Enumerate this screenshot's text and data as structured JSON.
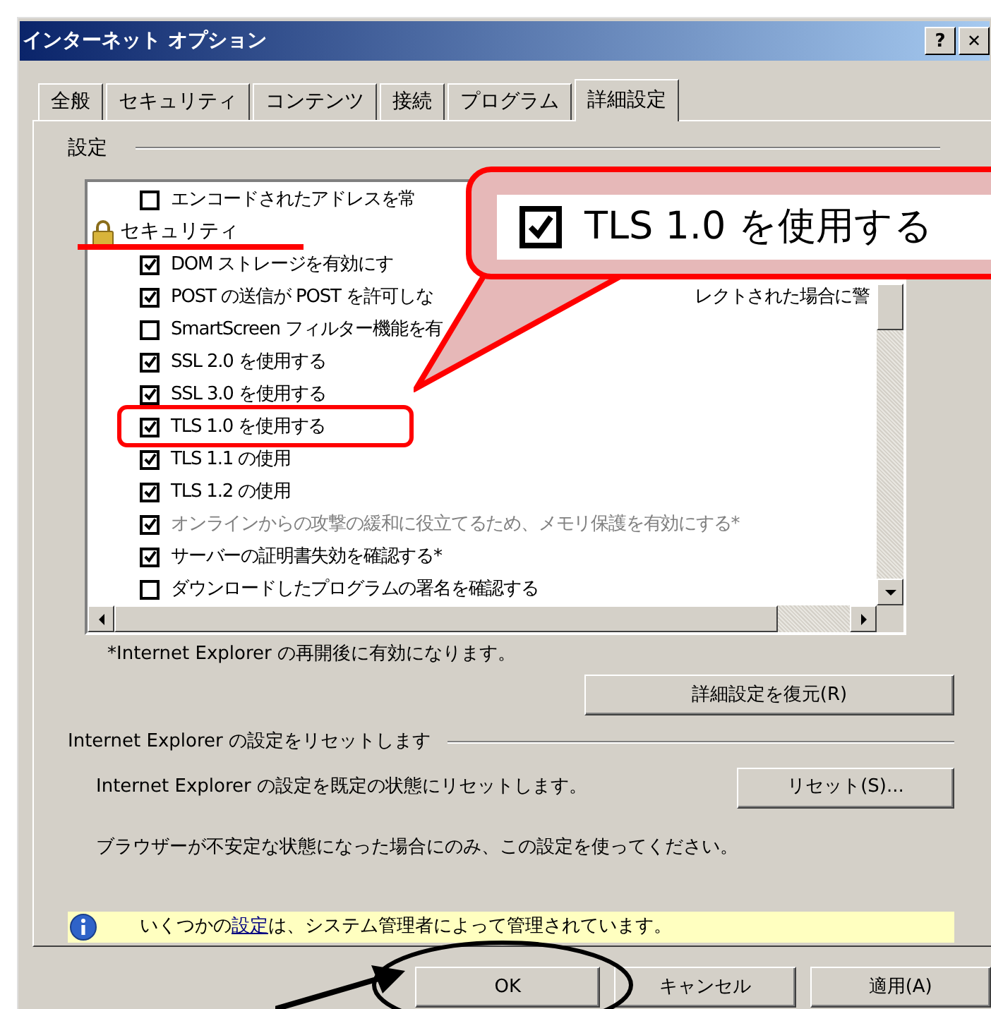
{
  "window": {
    "title": "インターネット オプション",
    "help_button": "?",
    "close_button": "✕"
  },
  "tabs": [
    {
      "label": "全般",
      "selected": false
    },
    {
      "label": "セキュリティ",
      "selected": false
    },
    {
      "label": "コンテンツ",
      "selected": false
    },
    {
      "label": "接続",
      "selected": false
    },
    {
      "label": "プログラム",
      "selected": false
    },
    {
      "label": "詳細設定",
      "selected": true
    }
  ],
  "settings": {
    "heading": "設定",
    "items": [
      {
        "kind": "checkbox",
        "text": "エンコードされたアドレスを常",
        "checked": false,
        "disabled": false
      },
      {
        "kind": "category",
        "text": "セキュリティ"
      },
      {
        "kind": "checkbox",
        "text": "DOM ストレージを有効にす",
        "checked": true,
        "disabled": false
      },
      {
        "kind": "checkbox",
        "text": "POST の送信が POST を許可しな",
        "tail": "レクトされた場合に警",
        "checked": true,
        "disabled": false
      },
      {
        "kind": "checkbox",
        "text": "SmartScreen フィルター機能を有",
        "checked": false,
        "disabled": false
      },
      {
        "kind": "checkbox",
        "text": "SSL 2.0 を使用する",
        "checked": true,
        "disabled": false
      },
      {
        "kind": "checkbox",
        "text": "SSL 3.0 を使用する",
        "checked": true,
        "disabled": false
      },
      {
        "kind": "checkbox",
        "text": "TLS 1.0 を使用する",
        "checked": true,
        "disabled": false
      },
      {
        "kind": "checkbox",
        "text": "TLS 1.1 の使用",
        "checked": true,
        "disabled": false
      },
      {
        "kind": "checkbox",
        "text": "TLS 1.2 の使用",
        "checked": true,
        "disabled": false
      },
      {
        "kind": "checkbox",
        "text": "オンラインからの攻撃の緩和に役立てるため、メモリ保護を有効にする*",
        "checked": true,
        "disabled": true
      },
      {
        "kind": "checkbox",
        "text": "サーバーの証明書失効を確認する*",
        "checked": true,
        "disabled": false
      },
      {
        "kind": "checkbox",
        "text": "ダウンロードしたプログラムの署名を確認する",
        "checked": false,
        "disabled": false
      }
    ],
    "footnote": "*Internet Explorer の再開後に有効になります。",
    "restore_button": "詳細設定を復元(R)"
  },
  "reset": {
    "heading": "Internet Explorer の設定をリセットします",
    "description": "Internet Explorer の設定を既定の状態にリセットします。",
    "button": "リセット(S)...",
    "warning": "ブラウザーが不安定な状態になった場合にのみ、この設定を使ってください。"
  },
  "info_bar": {
    "before": "いくつかの",
    "link": "設定",
    "after": "は、システム管理者によって管理されています。"
  },
  "buttons": [
    "OK",
    "キャンセル",
    "適用(A)"
  ],
  "annotation": {
    "callout_text": "TLS 1.0 を使用する",
    "callout_checked": true
  }
}
